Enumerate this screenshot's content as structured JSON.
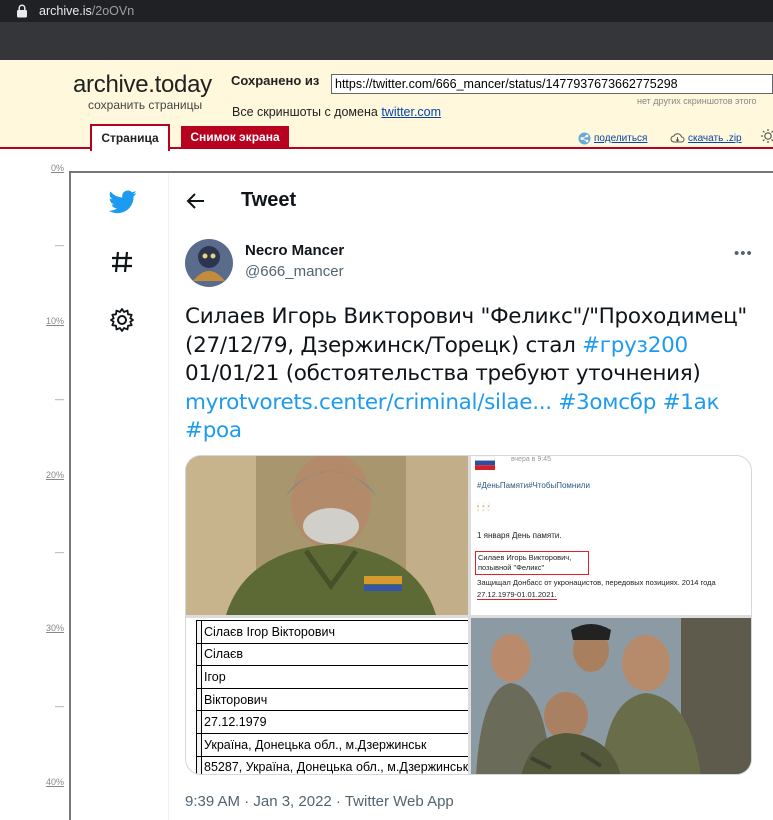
{
  "browser": {
    "url_domain": "archive.is",
    "url_path": "/2oOVn"
  },
  "archive": {
    "logo": "archive.today",
    "tagline": "сохранить страницы",
    "saved_from_label": "Сохранено из",
    "saved_url": "https://twitter.com/666_mancer/status/1477937673662775298",
    "no_other_snapshots": "нет других скриншотов этого",
    "all_screenshots_prefix": "Все скриншоты   с домена",
    "domain_link": "twitter.com",
    "tab_page": "Страница",
    "tab_screenshot": "Снимок экрана",
    "share_label": "поделиться",
    "download_label": "скачать .zip",
    "colors": {
      "header_bg": "#fff8dc",
      "accent": "#b8001f",
      "link": "#0645ad"
    }
  },
  "ruler": [
    {
      "label": "0%",
      "kind": "pct"
    },
    {
      "label": "—",
      "kind": "tick"
    },
    {
      "label": "10%",
      "kind": "pct"
    },
    {
      "label": "—",
      "kind": "tick"
    },
    {
      "label": "20%",
      "kind": "pct"
    },
    {
      "label": "—",
      "kind": "tick"
    },
    {
      "label": "30%",
      "kind": "pct"
    },
    {
      "label": "—",
      "kind": "tick"
    },
    {
      "label": "40%",
      "kind": "pct"
    }
  ],
  "twitter": {
    "nav_icons": [
      "twitter-bird-icon",
      "hashtag-icon",
      "settings-gear-icon"
    ],
    "header_title": "Tweet",
    "author_name": "Necro Mancer",
    "author_handle": "@666_mancer",
    "more_label": "•••",
    "text": {
      "part1": "Силаев Игорь Викторович \"Феликс\"/\"Проходимец\" (27/12/79, Дзержинск/Торецк) стал ",
      "hashtag1": "#груз200",
      "part2": " 01/01/21 (обстоятельства требуют уточнения) ",
      "link": "myrotvorets.center/criminal/silae...",
      "hashtag2": "#3омсбр",
      "hashtag3": "#1ак",
      "hashtag4": "#роа"
    },
    "meta": "9:39 AM · Jan 3, 2022 · Twitter Web App",
    "accent": "#1d9bf0"
  },
  "media": {
    "doc_rows": [
      "Сілаєв Ігор Вікторович",
      "Сілаєв",
      "Ігор",
      "Вікторович",
      "27.12.1979",
      "Україна, Донецька обл., м.Дзержинськ",
      "85287, Україна, Донецька обл., м.Дзержинськ"
    ],
    "vk_post": {
      "date": "вчера в 9:45",
      "tags": "#ДеньПамяти#ЧтобыПомнили",
      "candles": "🕯🕯🕯",
      "day": "1 января День памяти.",
      "name_line1": "Силаев Игорь Викторович,",
      "name_line2": "позывной \"Феликс\"",
      "line": "Защищал Донбасс от укронацистов, передовых позициях. 2014 года",
      "dates": "27.12.1979-01.01.2021."
    }
  }
}
